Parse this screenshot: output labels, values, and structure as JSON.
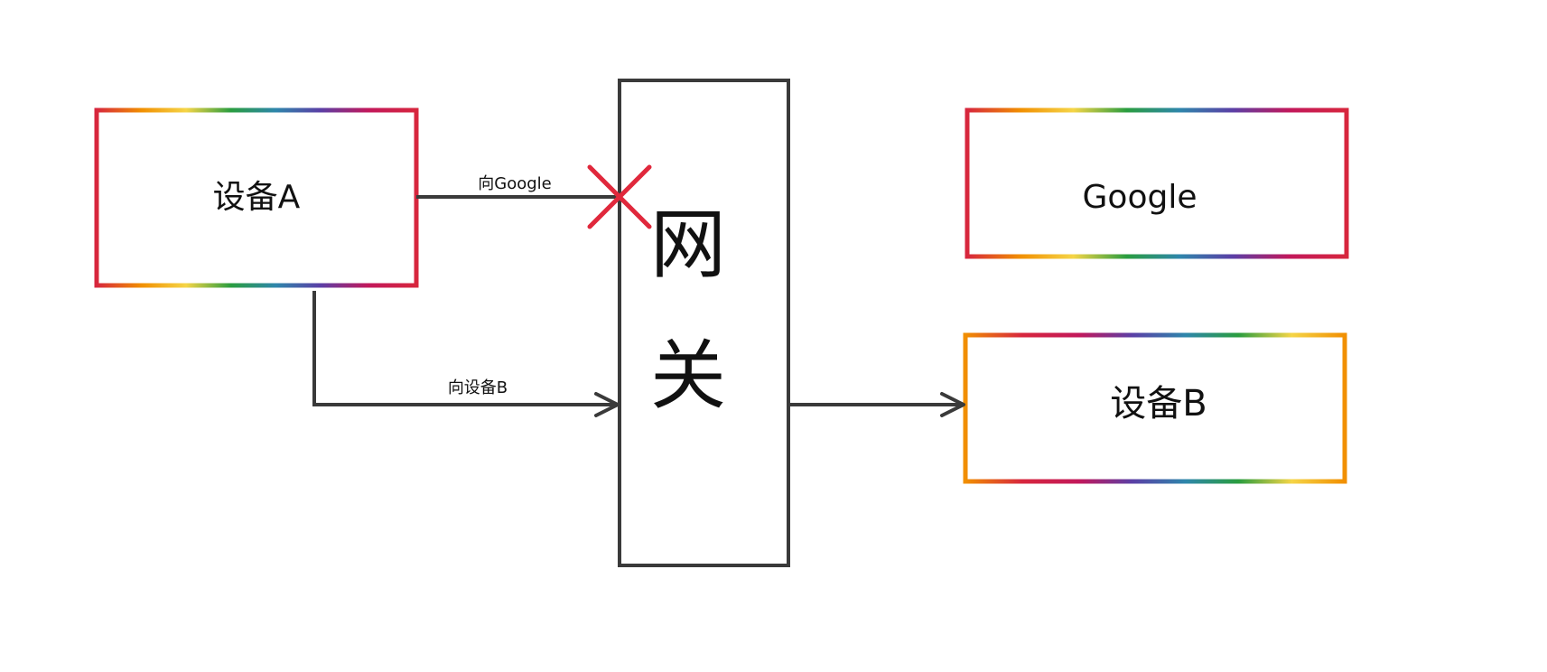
{
  "nodes": {
    "device_a": {
      "label": "设备A"
    },
    "gateway": {
      "label_line1": "网",
      "label_line2": "关"
    },
    "google": {
      "label": "Google"
    },
    "device_b": {
      "label": "设备B"
    }
  },
  "edges": {
    "a_to_google": {
      "label": "向Google",
      "status": "blocked"
    },
    "a_to_b": {
      "label": "向设备B",
      "status": "allowed"
    },
    "gateway_to_b": {
      "label": "",
      "status": "allowed"
    }
  },
  "colors": {
    "line": "#3a3a3a",
    "blocked_mark": "#e0283c",
    "rainbow": [
      "#d7263d",
      "#f18f01",
      "#f5d547",
      "#2a9d3f",
      "#2e86ab",
      "#5b3fa6",
      "#c2185b",
      "#d7263d"
    ]
  }
}
